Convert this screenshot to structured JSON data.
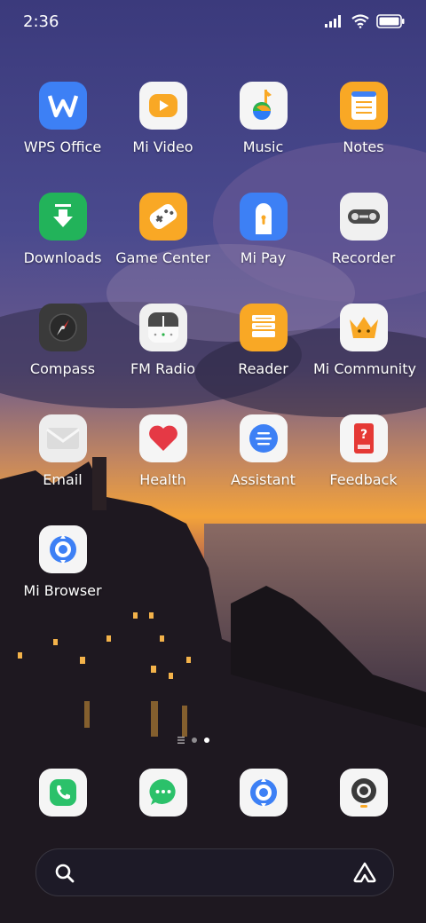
{
  "status_bar": {
    "time": "2:36",
    "icons": [
      "signal-icon",
      "wifi-icon",
      "battery-icon"
    ]
  },
  "apps": [
    {
      "label": "WPS Office",
      "icon": "wps-office-icon",
      "bg": "#3D80F5"
    },
    {
      "label": "Mi Video",
      "icon": "mi-video-icon",
      "bg": "#F5F5F5"
    },
    {
      "label": "Music",
      "icon": "music-icon",
      "bg": "#F5F5F5"
    },
    {
      "label": "Notes",
      "icon": "notes-icon",
      "bg": "#F9A825"
    },
    {
      "label": "Downloads",
      "icon": "downloads-icon",
      "bg": "#22B35A"
    },
    {
      "label": "Game Center",
      "icon": "game-center-icon",
      "bg": "#F9A825"
    },
    {
      "label": "Mi Pay",
      "icon": "mi-pay-icon",
      "bg": "#3D80F5"
    },
    {
      "label": "Recorder",
      "icon": "recorder-icon",
      "bg": "#F0F0F0"
    },
    {
      "label": "Compass",
      "icon": "compass-icon",
      "bg": "#3A3A3A"
    },
    {
      "label": "FM Radio",
      "icon": "fm-radio-icon",
      "bg": "#F0F0F0"
    },
    {
      "label": "Reader",
      "icon": "reader-icon",
      "bg": "#F9A825"
    },
    {
      "label": "Mi Community",
      "icon": "mi-community-icon",
      "bg": "#F5F5F5"
    },
    {
      "label": "Email",
      "icon": "email-icon",
      "bg": "#EDEDED"
    },
    {
      "label": "Health",
      "icon": "health-icon",
      "bg": "#F5F5F5"
    },
    {
      "label": "Assistant",
      "icon": "assistant-icon",
      "bg": "#F5F5F5"
    },
    {
      "label": "Feedback",
      "icon": "feedback-icon",
      "bg": "#F5F5F5"
    },
    {
      "label": "Mi Browser",
      "icon": "mi-browser-icon",
      "bg": "#F5F5F5"
    }
  ],
  "page_indicator": {
    "pages": 2,
    "current": 2
  },
  "dock": [
    {
      "name": "phone",
      "icon": "phone-icon",
      "bg": "#F5F5F5"
    },
    {
      "name": "messages",
      "icon": "messages-icon",
      "bg": "#F5F5F5"
    },
    {
      "name": "browser",
      "icon": "mi-browser-icon",
      "bg": "#F5F5F5"
    },
    {
      "name": "camera",
      "icon": "camera-icon",
      "bg": "#F5F5F5"
    }
  ],
  "search_bar": {
    "left_icon": "search-icon",
    "right_icon": "assistant-logo-icon"
  }
}
